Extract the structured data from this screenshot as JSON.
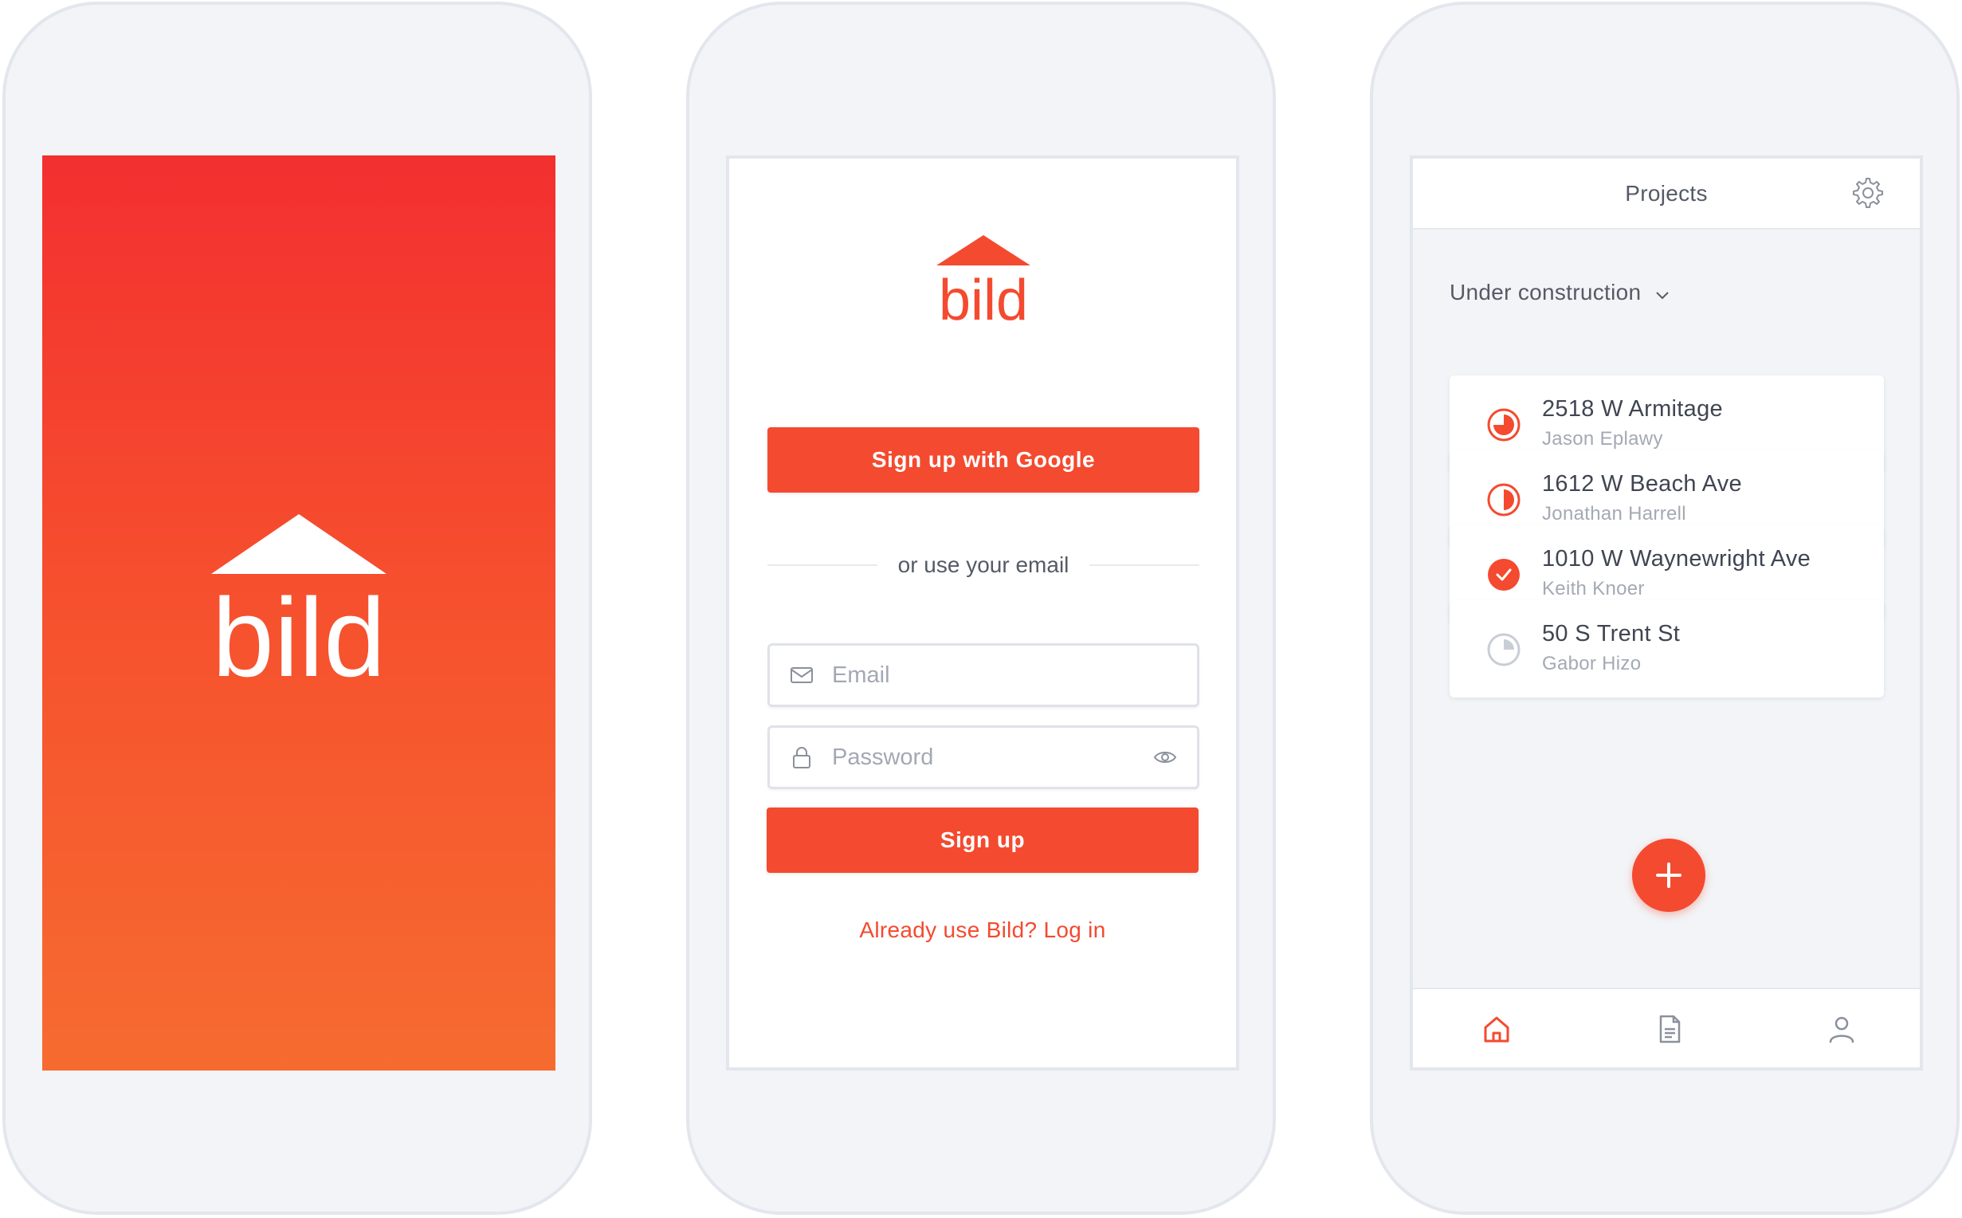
{
  "splash": {
    "logo_text": "bild",
    "colors": {
      "gradient_top": "#f32f30",
      "gradient_bottom": "#f66b30"
    }
  },
  "signup": {
    "logo_text": "bild",
    "google_button": "Sign up with Google",
    "divider_text": "or use your email",
    "email_placeholder": "Email",
    "password_placeholder": "Password",
    "signup_button": "Sign up",
    "login_link": "Already use Bild? Log in"
  },
  "projects": {
    "title": "Projects",
    "filter_label": "Under construction",
    "items": [
      {
        "address": "2518 W Armitage",
        "owner": "Jason Eplawy",
        "status": "progress-three-quarters-icon"
      },
      {
        "address": "1612 W Beach Ave",
        "owner": "Jonathan Harrell",
        "status": "progress-half-icon"
      },
      {
        "address": "1010 W Waynewright Ave",
        "owner": "Keith Knoer",
        "status": "completed-check-icon"
      },
      {
        "address": "50 S Trent St",
        "owner": "Gabor Hizo",
        "status": "progress-quarter-icon"
      }
    ],
    "tabs": [
      "home-icon",
      "document-icon",
      "user-icon"
    ]
  },
  "colors": {
    "accent": "#f44a2f",
    "text_dark": "#404552",
    "text_muted": "#a4a9b4",
    "phone_bg": "#f2f4f7"
  }
}
